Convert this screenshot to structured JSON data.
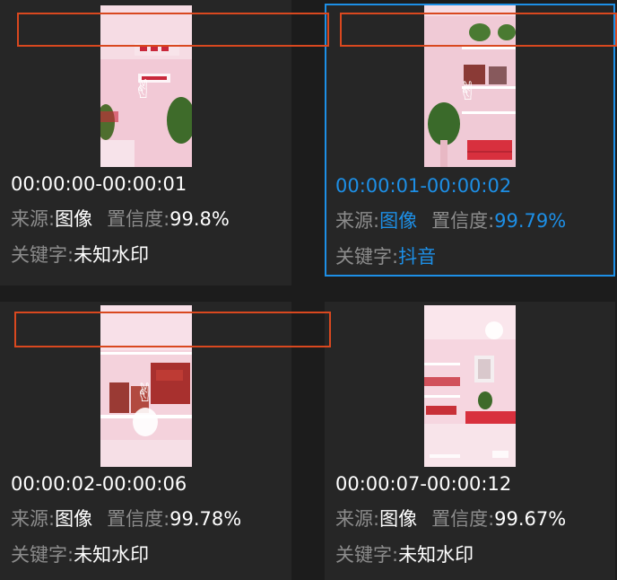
{
  "labels": {
    "source": "来源:",
    "confidence": "置信度:",
    "keyword": "关键字:"
  },
  "colors": {
    "background": "#1c1c1c",
    "card": "#262626",
    "selected_border": "#1d8fe6",
    "highlight_text": "#1d8fe6",
    "detection_box": "#d9481f",
    "label_text": "#8c8c8c",
    "value_text": "#ffffff"
  },
  "results": [
    {
      "time_range": "00:00:00-00:00:01",
      "source": "图像",
      "confidence": "99.8%",
      "keyword": "未知水印",
      "selected": false
    },
    {
      "time_range": "00:00:01-00:00:02",
      "source": "图像",
      "confidence": "99.79%",
      "keyword": "抖音",
      "selected": true
    },
    {
      "time_range": "00:00:02-00:00:06",
      "source": "图像",
      "confidence": "99.78%",
      "keyword": "未知水印",
      "selected": false
    },
    {
      "time_range": "00:00:07-00:00:12",
      "source": "图像",
      "confidence": "99.67%",
      "keyword": "未知水印",
      "selected": false
    }
  ]
}
